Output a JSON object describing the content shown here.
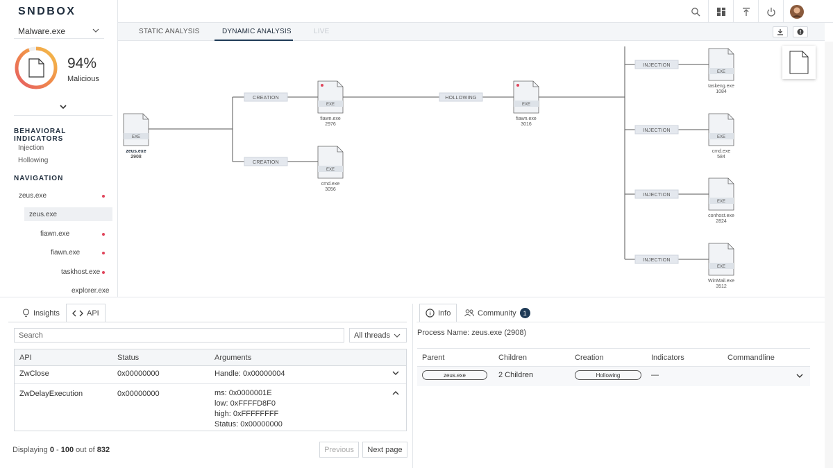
{
  "app": {
    "logo": "SNDBOX"
  },
  "file": {
    "name": "Malware.exe"
  },
  "score": {
    "value": "94%",
    "label": "Malicious",
    "fraction": 0.94
  },
  "behavioral": {
    "title": "BEHAVIORAL INDICATORS",
    "items": [
      "Injection",
      "Hollowing"
    ]
  },
  "navigation": {
    "title": "NAVIGATION",
    "items": [
      {
        "label": "zeus.exe",
        "dot": true
      },
      {
        "label": "zeus.exe",
        "dot": false
      },
      {
        "label": "fiawn.exe",
        "dot": true
      },
      {
        "label": "fiawn.exe",
        "dot": true
      },
      {
        "label": "taskhost.exe",
        "dot": true
      },
      {
        "label": "explorer.exe",
        "dot": false
      }
    ]
  },
  "tabs": [
    "STATIC ANALYSIS",
    "DYNAMIC ANALYSIS",
    "LIVE"
  ],
  "graph": {
    "nodes": [
      {
        "id": "zeus",
        "name": "zeus.exe",
        "pid": "2908",
        "type": "EXE",
        "dot": false,
        "bold": true
      },
      {
        "id": "fiawn1",
        "name": "fiawn.exe",
        "pid": "2976",
        "type": "EXE",
        "dot": true
      },
      {
        "id": "cmd1",
        "name": "cmd.exe",
        "pid": "3056",
        "type": "EXE",
        "dot": false
      },
      {
        "id": "fiawn2",
        "name": "fiawn.exe",
        "pid": "3016",
        "type": "EXE",
        "dot": true
      },
      {
        "id": "taskeng",
        "name": "taskeng.exe",
        "pid": "1084",
        "type": "EXE",
        "dot": false
      },
      {
        "id": "cmd2",
        "name": "cmd.exe",
        "pid": "584",
        "type": "EXE",
        "dot": false
      },
      {
        "id": "conhost",
        "name": "conhost.exe",
        "pid": "2824",
        "type": "EXE",
        "dot": false
      },
      {
        "id": "winmail",
        "name": "WinMail.exe",
        "pid": "3512",
        "type": "EXE",
        "dot": false
      }
    ],
    "edges": [
      {
        "from": "zeus",
        "to": "fiawn1",
        "label": "CREATION"
      },
      {
        "from": "zeus",
        "to": "cmd1",
        "label": "CREATION"
      },
      {
        "from": "fiawn1",
        "to": "fiawn2",
        "label": "HOLLOWING"
      },
      {
        "from": "fiawn2",
        "to": "taskeng",
        "label": "INJECTION"
      },
      {
        "from": "fiawn2",
        "to": "cmd2",
        "label": "INJECTION"
      },
      {
        "from": "fiawn2",
        "to": "conhost",
        "label": "INJECTION"
      },
      {
        "from": "fiawn2",
        "to": "winmail",
        "label": "INJECTION"
      }
    ]
  },
  "left_panel": {
    "tabs": [
      {
        "label": "Insights",
        "icon": "lightbulb-icon"
      },
      {
        "label": "API",
        "icon": "code-icon"
      }
    ],
    "search_placeholder": "Search",
    "threads": "All threads",
    "columns": [
      "API",
      "Status",
      "Arguments"
    ],
    "rows": [
      {
        "api": "ZwClose",
        "status": "0x00000000",
        "args": [
          "Handle: 0x00000004"
        ],
        "expanded": false
      },
      {
        "api": "ZwDelayExecution",
        "status": "0x00000000",
        "args": [
          "ms: 0x0000001E",
          "low: 0xFFFFD8F0",
          "high: 0xFFFFFFFF",
          "Status: 0x00000000"
        ],
        "expanded": true
      }
    ],
    "footer": {
      "prefix": "Displaying",
      "from": "0",
      "sep": "-",
      "to": "100",
      "mid": "out of",
      "total": "832"
    },
    "prev": "Previous",
    "next": "Next page"
  },
  "right_panel": {
    "tabs": [
      {
        "label": "Info",
        "icon": "info-icon"
      },
      {
        "label": "Community",
        "icon": "people-icon",
        "badge": "1"
      }
    ],
    "process_name": "Process Name: zeus.exe (2908)",
    "columns": [
      "Parent",
      "Children",
      "Creation",
      "Indicators",
      "Commandline"
    ],
    "row": {
      "parent": "zeus.exe",
      "children": "2 Children",
      "creation": "Hollowing",
      "indicators": "—"
    }
  },
  "colors": {
    "accent": "#1f3b57",
    "danger": "#e0455b",
    "ring_start": "#f4a54a",
    "ring_end": "#e55b63"
  }
}
